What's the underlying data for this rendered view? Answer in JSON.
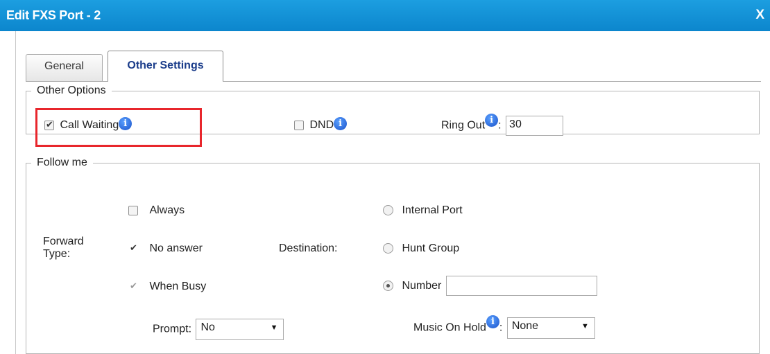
{
  "dialog": {
    "title": "Edit FXS Port - 2",
    "close_label": "X"
  },
  "tabs": [
    {
      "label": "General",
      "active": false
    },
    {
      "label": "Other Settings",
      "active": true
    }
  ],
  "other_options": {
    "legend": "Other Options",
    "call_waiting": {
      "label": "Call Waiting",
      "checked": true
    },
    "dnd": {
      "label": "DND",
      "checked": false
    },
    "ring_out": {
      "label": "Ring Out",
      "value": "30"
    }
  },
  "follow_me": {
    "legend": "Follow me",
    "forward_type_label": "Forward Type:",
    "forward_type_line1": "Forward",
    "forward_type_line2": "Type:",
    "always": {
      "label": "Always",
      "checked": false
    },
    "no_answer": {
      "label": "No answer",
      "checked": true
    },
    "when_busy": {
      "label": "When Busy",
      "checked": true,
      "disabled": true
    },
    "destination_label": "Destination:",
    "internal_port": {
      "label": "Internal Port",
      "selected": false
    },
    "hunt_group": {
      "label": "Hunt Group",
      "selected": false
    },
    "number": {
      "label": "Number",
      "selected": true,
      "value": ""
    },
    "prompt": {
      "label": "Prompt:",
      "value": "No"
    },
    "music_on_hold": {
      "label": "Music On Hold",
      "value": "None"
    }
  },
  "info_icon_glyph": "i",
  "colors": {
    "titlebar": "#0c86cd",
    "highlight": "#e8262c",
    "active_tab_text": "#1a3c8a"
  }
}
